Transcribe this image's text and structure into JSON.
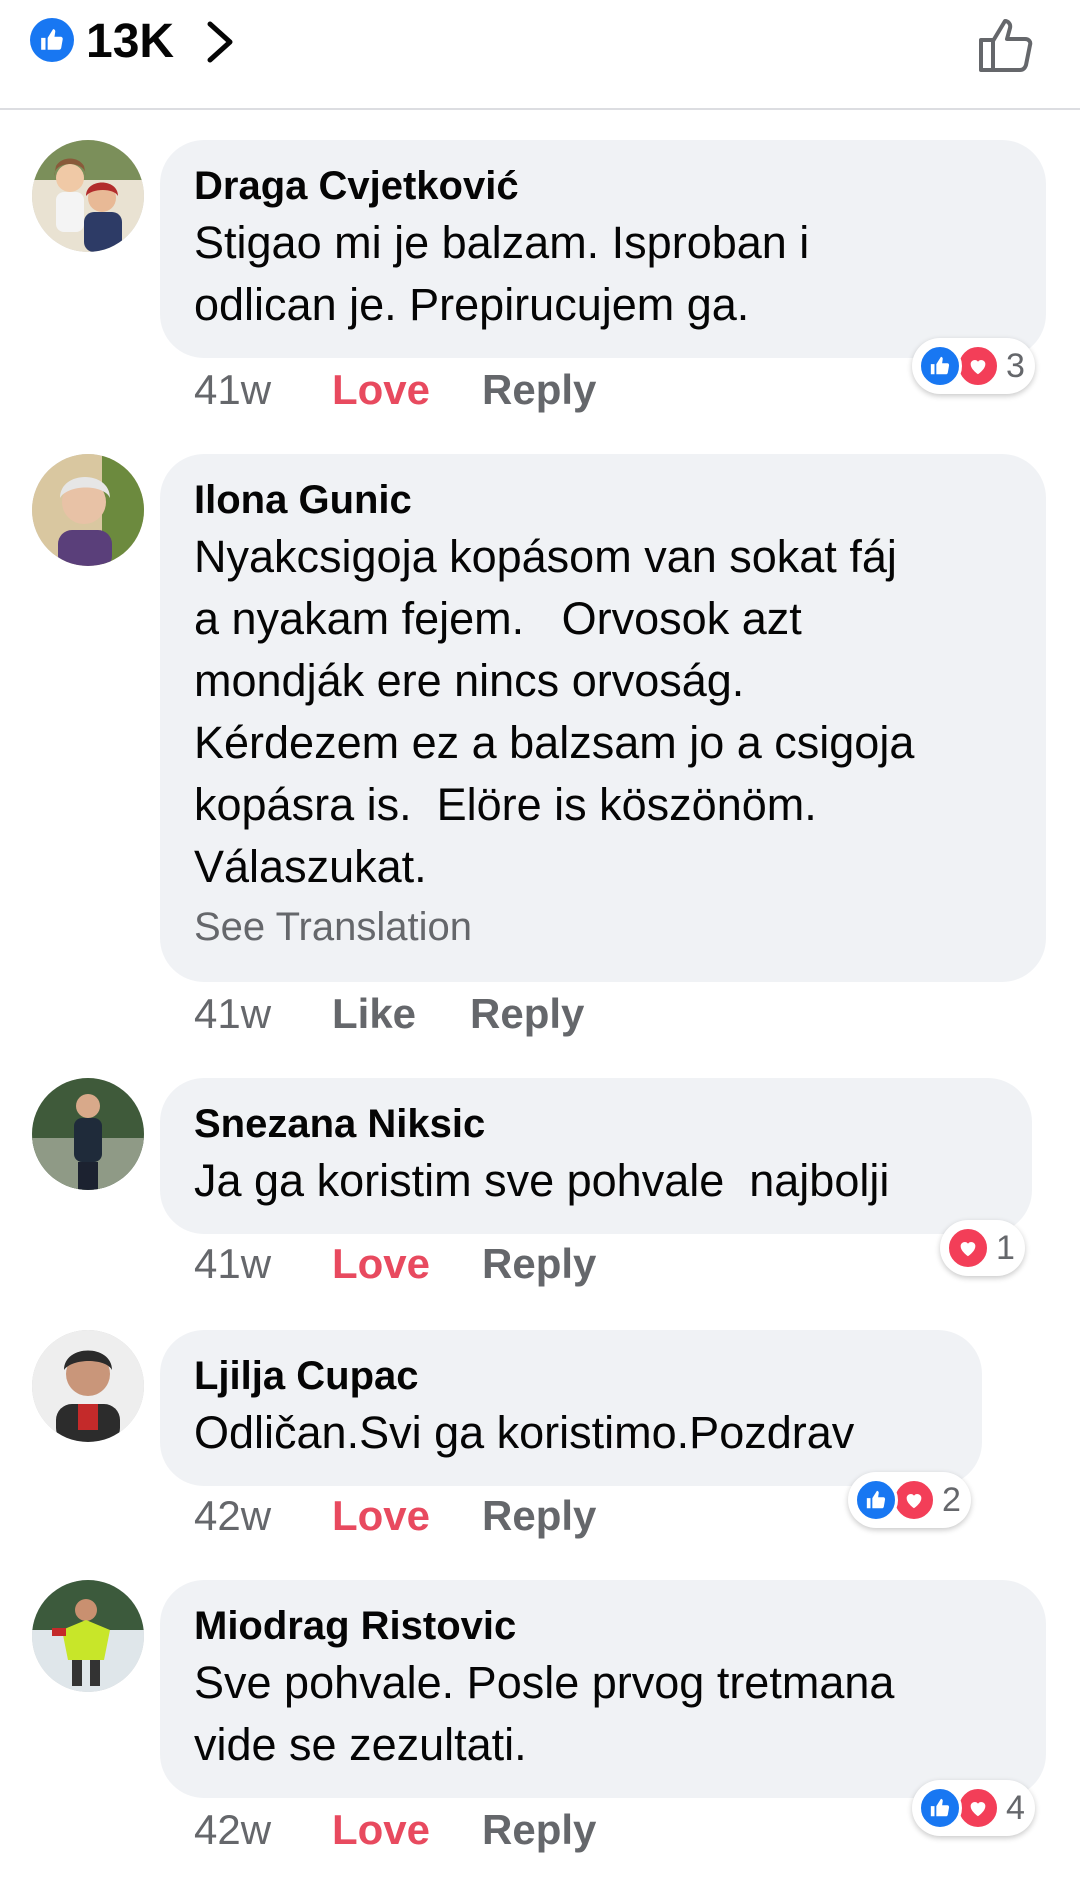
{
  "header": {
    "reaction_count": "13K"
  },
  "colors": {
    "like_blue": "#1877f2",
    "love_red": "#f33e58",
    "love_text": "#e84a5f",
    "bubble_bg": "#f0f2f5",
    "muted_text": "#65676b"
  },
  "comments": [
    {
      "author": "Draga Cvjetković",
      "text": "Stigao mi je balzam. Isproban i\nodlican je. Prepirucujem ga.",
      "time": "41w",
      "reaction_action": "Love",
      "reply_label": "Reply",
      "reactions": {
        "icons": [
          "like-icon",
          "love-icon"
        ],
        "count": "3"
      }
    },
    {
      "author": "Ilona Gunic",
      "text": "Nyakcsigoja kopásom van sokat fáj\na nyakam fejem.   Orvosok azt\nmondják ere nincs orvoság.\nKérdezem ez a balzsam jo a csigoja\nkopásra is.  Elöre is köszönöm.\nVálaszukat.",
      "see_translation": "See Translation",
      "time": "41w",
      "reaction_action": "Like",
      "reply_label": "Reply"
    },
    {
      "author": "Snezana Niksic",
      "text": "Ja ga koristim sve pohvale  najbolji",
      "time": "41w",
      "reaction_action": "Love",
      "reply_label": "Reply",
      "reactions": {
        "icons": [
          "love-icon"
        ],
        "count": "1"
      }
    },
    {
      "author": "Ljilja Cupac",
      "text": "Odličan.Svi ga koristimo.Pozdrav",
      "time": "42w",
      "reaction_action": "Love",
      "reply_label": "Reply",
      "reactions": {
        "icons": [
          "like-icon",
          "love-icon"
        ],
        "count": "2"
      }
    },
    {
      "author": "Miodrag Ristovic",
      "text": "Sve pohvale. Posle prvog tretmana\nvide se zezultati.",
      "time": "42w",
      "reaction_action": "Love",
      "reply_label": "Reply",
      "reactions": {
        "icons": [
          "like-icon",
          "love-icon"
        ],
        "count": "4"
      }
    }
  ]
}
